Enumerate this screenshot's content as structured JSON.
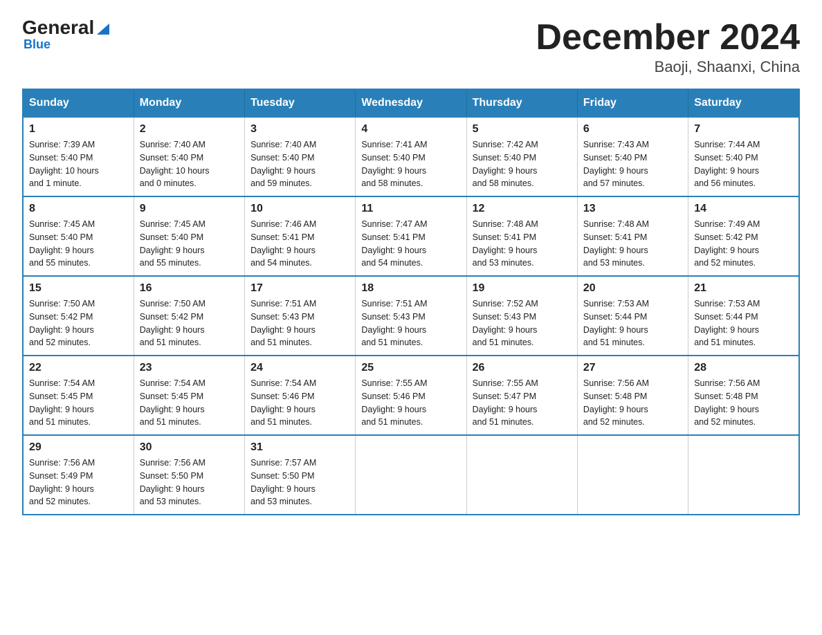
{
  "header": {
    "logo_main": "General",
    "logo_sub": "Blue",
    "title": "December 2024",
    "subtitle": "Baoji, Shaanxi, China"
  },
  "days_of_week": [
    "Sunday",
    "Monday",
    "Tuesday",
    "Wednesday",
    "Thursday",
    "Friday",
    "Saturday"
  ],
  "weeks": [
    [
      {
        "day": "1",
        "sunrise": "7:39 AM",
        "sunset": "5:40 PM",
        "daylight": "10 hours and 1 minute."
      },
      {
        "day": "2",
        "sunrise": "7:40 AM",
        "sunset": "5:40 PM",
        "daylight": "10 hours and 0 minutes."
      },
      {
        "day": "3",
        "sunrise": "7:40 AM",
        "sunset": "5:40 PM",
        "daylight": "9 hours and 59 minutes."
      },
      {
        "day": "4",
        "sunrise": "7:41 AM",
        "sunset": "5:40 PM",
        "daylight": "9 hours and 58 minutes."
      },
      {
        "day": "5",
        "sunrise": "7:42 AM",
        "sunset": "5:40 PM",
        "daylight": "9 hours and 58 minutes."
      },
      {
        "day": "6",
        "sunrise": "7:43 AM",
        "sunset": "5:40 PM",
        "daylight": "9 hours and 57 minutes."
      },
      {
        "day": "7",
        "sunrise": "7:44 AM",
        "sunset": "5:40 PM",
        "daylight": "9 hours and 56 minutes."
      }
    ],
    [
      {
        "day": "8",
        "sunrise": "7:45 AM",
        "sunset": "5:40 PM",
        "daylight": "9 hours and 55 minutes."
      },
      {
        "day": "9",
        "sunrise": "7:45 AM",
        "sunset": "5:40 PM",
        "daylight": "9 hours and 55 minutes."
      },
      {
        "day": "10",
        "sunrise": "7:46 AM",
        "sunset": "5:41 PM",
        "daylight": "9 hours and 54 minutes."
      },
      {
        "day": "11",
        "sunrise": "7:47 AM",
        "sunset": "5:41 PM",
        "daylight": "9 hours and 54 minutes."
      },
      {
        "day": "12",
        "sunrise": "7:48 AM",
        "sunset": "5:41 PM",
        "daylight": "9 hours and 53 minutes."
      },
      {
        "day": "13",
        "sunrise": "7:48 AM",
        "sunset": "5:41 PM",
        "daylight": "9 hours and 53 minutes."
      },
      {
        "day": "14",
        "sunrise": "7:49 AM",
        "sunset": "5:42 PM",
        "daylight": "9 hours and 52 minutes."
      }
    ],
    [
      {
        "day": "15",
        "sunrise": "7:50 AM",
        "sunset": "5:42 PM",
        "daylight": "9 hours and 52 minutes."
      },
      {
        "day": "16",
        "sunrise": "7:50 AM",
        "sunset": "5:42 PM",
        "daylight": "9 hours and 51 minutes."
      },
      {
        "day": "17",
        "sunrise": "7:51 AM",
        "sunset": "5:43 PM",
        "daylight": "9 hours and 51 minutes."
      },
      {
        "day": "18",
        "sunrise": "7:51 AM",
        "sunset": "5:43 PM",
        "daylight": "9 hours and 51 minutes."
      },
      {
        "day": "19",
        "sunrise": "7:52 AM",
        "sunset": "5:43 PM",
        "daylight": "9 hours and 51 minutes."
      },
      {
        "day": "20",
        "sunrise": "7:53 AM",
        "sunset": "5:44 PM",
        "daylight": "9 hours and 51 minutes."
      },
      {
        "day": "21",
        "sunrise": "7:53 AM",
        "sunset": "5:44 PM",
        "daylight": "9 hours and 51 minutes."
      }
    ],
    [
      {
        "day": "22",
        "sunrise": "7:54 AM",
        "sunset": "5:45 PM",
        "daylight": "9 hours and 51 minutes."
      },
      {
        "day": "23",
        "sunrise": "7:54 AM",
        "sunset": "5:45 PM",
        "daylight": "9 hours and 51 minutes."
      },
      {
        "day": "24",
        "sunrise": "7:54 AM",
        "sunset": "5:46 PM",
        "daylight": "9 hours and 51 minutes."
      },
      {
        "day": "25",
        "sunrise": "7:55 AM",
        "sunset": "5:46 PM",
        "daylight": "9 hours and 51 minutes."
      },
      {
        "day": "26",
        "sunrise": "7:55 AM",
        "sunset": "5:47 PM",
        "daylight": "9 hours and 51 minutes."
      },
      {
        "day": "27",
        "sunrise": "7:56 AM",
        "sunset": "5:48 PM",
        "daylight": "9 hours and 52 minutes."
      },
      {
        "day": "28",
        "sunrise": "7:56 AM",
        "sunset": "5:48 PM",
        "daylight": "9 hours and 52 minutes."
      }
    ],
    [
      {
        "day": "29",
        "sunrise": "7:56 AM",
        "sunset": "5:49 PM",
        "daylight": "9 hours and 52 minutes."
      },
      {
        "day": "30",
        "sunrise": "7:56 AM",
        "sunset": "5:50 PM",
        "daylight": "9 hours and 53 minutes."
      },
      {
        "day": "31",
        "sunrise": "7:57 AM",
        "sunset": "5:50 PM",
        "daylight": "9 hours and 53 minutes."
      },
      null,
      null,
      null,
      null
    ]
  ],
  "labels": {
    "sunrise": "Sunrise:",
    "sunset": "Sunset:",
    "daylight": "Daylight:"
  }
}
